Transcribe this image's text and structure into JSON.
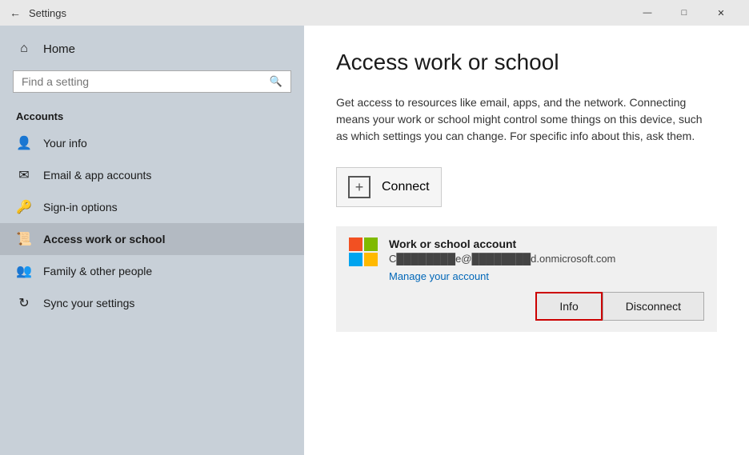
{
  "titlebar": {
    "back_label": "←",
    "title": "Settings",
    "minimize": "—",
    "maximize": "□",
    "close": "✕"
  },
  "sidebar": {
    "home_label": "Home",
    "search_placeholder": "Find a setting",
    "section_label": "Accounts",
    "items": [
      {
        "id": "your-info",
        "icon": "👤",
        "label": "Your info"
      },
      {
        "id": "email-app-accounts",
        "icon": "✉",
        "label": "Email & app accounts"
      },
      {
        "id": "sign-in-options",
        "icon": "🔑",
        "label": "Sign-in options"
      },
      {
        "id": "access-work-school",
        "icon": "💼",
        "label": "Access work or school"
      },
      {
        "id": "family-other-people",
        "icon": "👥",
        "label": "Family & other people"
      },
      {
        "id": "sync-settings",
        "icon": "🔄",
        "label": "Sync your settings"
      }
    ]
  },
  "main": {
    "page_title": "Access work or school",
    "description": "Get access to resources like email, apps, and the network. Connecting means your work or school might control some things on this device, such as which settings you can change. For specific info about this, ask them.",
    "connect_label": "Connect",
    "account": {
      "name": "Work or school account",
      "email_prefix": "C",
      "email_middle": "████████e@",
      "email_suffix": "████████d.onmicrosoft.com",
      "manage_label": "Manage your account"
    },
    "actions": {
      "info_label": "Info",
      "disconnect_label": "Disconnect"
    }
  }
}
